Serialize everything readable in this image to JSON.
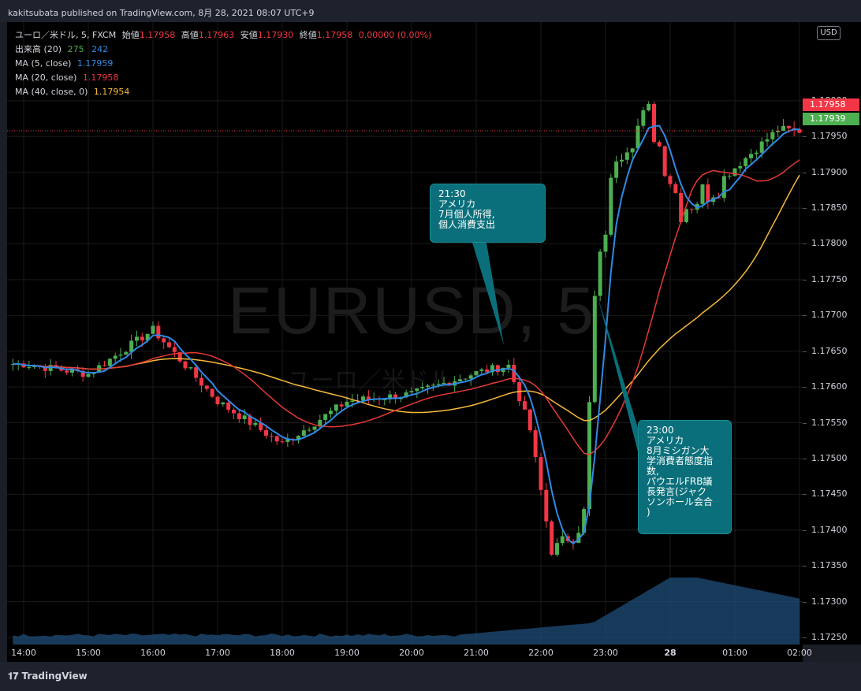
{
  "header": {
    "published": "kakitsubata published on TradingView.com, 8月 28, 2021 08:07 UTC+9"
  },
  "footer": {
    "brand": "TradingView"
  },
  "watermark": {
    "symbol": "EURUSD, 5",
    "name": "ユーロ／米ドル"
  },
  "legend": {
    "symbol": {
      "label": "ユーロ／米ドル, 5, FXCM",
      "open_k": "始値",
      "open": "1.17958",
      "high_k": "高値",
      "high": "1.17963",
      "low_k": "安値",
      "low": "1.17930",
      "close_k": "終値",
      "close": "1.17958",
      "chg": "0.00000 (0.00%)"
    },
    "volume": {
      "label": "出来高 (20)",
      "v1": "275",
      "v2": "242"
    },
    "ma5": {
      "label": "MA (5, close)",
      "value": "1.17959"
    },
    "ma20": {
      "label": "MA (20, close)",
      "value": "1.17958"
    },
    "ma40": {
      "label": "MA (40, close, 0)",
      "value": "1.17954"
    }
  },
  "yaxis": {
    "currency": "USD",
    "last_price": "1.17958",
    "ma5_price": "1.17939",
    "ticks": [
      "1.18000",
      "1.17950",
      "1.17900",
      "1.17850",
      "1.17800",
      "1.17750",
      "1.17700",
      "1.17650",
      "1.17600",
      "1.17550",
      "1.17500",
      "1.17450",
      "1.17400",
      "1.17350",
      "1.17300",
      "1.17250"
    ]
  },
  "annotations": [
    {
      "text": "21:30\nアメリカ\n7月個人所得,\n個人消費支出"
    },
    {
      "text": "23:00\nアメリカ\n8月ミシガン大\n学消費者態度指\n数,\nパウエルFRB議\n長発言(ジャク\nソンホール会合\n)"
    }
  ],
  "colors": {
    "up": "#4caf50",
    "down": "#f23645",
    "ma5": "#2f8ae6",
    "ma20": "#e53935",
    "ma40": "#f6b93b",
    "volume": "#1f4e79",
    "callout": "#0a6f7a"
  },
  "chart_data": {
    "type": "candlestick",
    "timeframe_minutes": 5,
    "x_labels": [
      "14:00",
      "15:00",
      "16:00",
      "17:00",
      "18:00",
      "19:00",
      "20:00",
      "21:00",
      "22:00",
      "23:00",
      "28",
      "01:00",
      "02:00"
    ],
    "y_range": [
      1.1724,
      1.1811
    ],
    "series": [
      {
        "name": "MA (5, close)",
        "last": 1.17959
      },
      {
        "name": "MA (20, close)",
        "last": 1.17958
      },
      {
        "name": "MA (40, close, 0)",
        "last": 1.17954
      },
      {
        "name": "出来高 (20)",
        "last": 275,
        "ma": 242
      }
    ],
    "keypoints": [
      [
        "14:00",
        1.17632
      ],
      [
        "15:00",
        1.17618
      ],
      [
        "16:00",
        1.1768
      ],
      [
        "17:00",
        1.1758
      ],
      [
        "18:00",
        1.1752
      ],
      [
        "19:00",
        1.1758
      ],
      [
        "20:00",
        1.1759
      ],
      [
        "21:00",
        1.1762
      ],
      [
        "21:30",
        1.1763
      ],
      [
        "21:50",
        1.1754
      ],
      [
        "22:10",
        1.1737
      ],
      [
        "22:40",
        1.1742
      ],
      [
        "22:50",
        1.1772
      ],
      [
        "23:10",
        1.1793
      ],
      [
        "23:40",
        1.1798
      ],
      [
        "00:10",
        1.1785
      ],
      [
        "00:40",
        1.1788
      ],
      [
        "01:10",
        1.1792
      ],
      [
        "01:40",
        1.1796
      ],
      [
        "02:00",
        1.17958
      ]
    ]
  }
}
